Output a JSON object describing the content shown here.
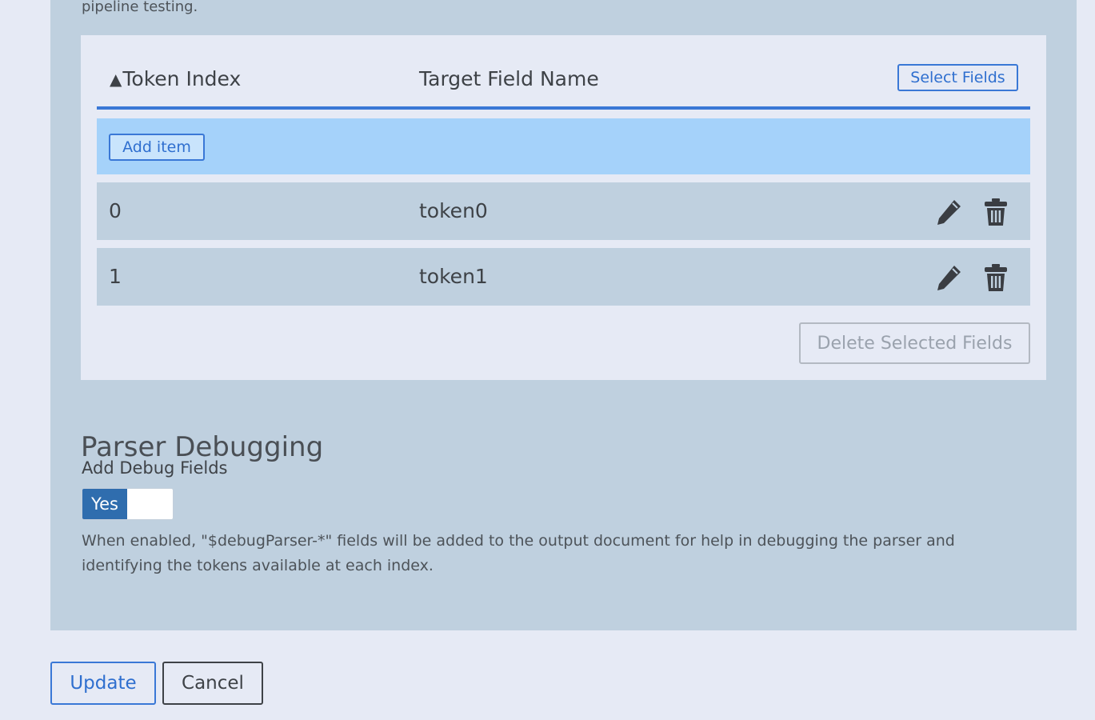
{
  "intro": {
    "text": "pipeline testing."
  },
  "table": {
    "columns": {
      "index": "Token Index",
      "target": "Target Field Name"
    },
    "sort_indicator": "▲",
    "select_fields_label": "Select Fields",
    "add_item_label": "Add item",
    "rows": [
      {
        "index": "0",
        "target": "token0"
      },
      {
        "index": "1",
        "target": "token1"
      }
    ],
    "row_icons": [
      "pencil-icon",
      "trash-icon"
    ],
    "delete_selected_label": "Delete Selected Fields"
  },
  "debugging": {
    "title": "Parser Debugging",
    "field_label": "Add Debug Fields",
    "toggle_value": "Yes",
    "toggle_on": true,
    "help": "When enabled, \"$debugParser-*\" fields will be added to the output document for help in debugging the parser and identifying the tokens available at each index."
  },
  "actions": {
    "update_label": "Update",
    "cancel_label": "Cancel"
  },
  "colors": {
    "panel_bg": "#bfd0df",
    "page_bg": "#e6eaf5",
    "accent": "#3a78d6",
    "add_row_bg": "#a5d2fa",
    "toggle_on": "#2f6dae"
  }
}
